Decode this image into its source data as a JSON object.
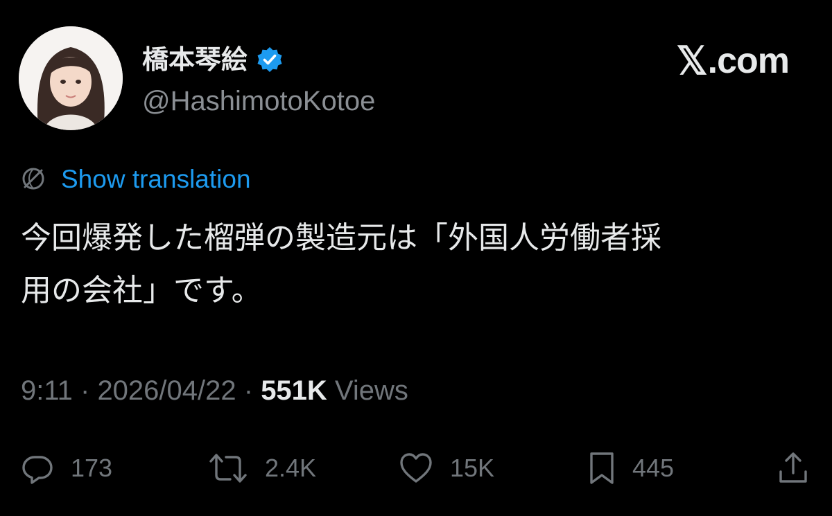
{
  "user": {
    "display_name": "橋本琴絵",
    "handle": "@HashimotoKotoe",
    "verified": true
  },
  "brand": {
    "x": "𝕏",
    "domain": ".com"
  },
  "translation": {
    "label": "Show translation"
  },
  "tweet": {
    "text": "今回爆発した榴弾の製造元は「外国人労働者採\n用の会社」です。"
  },
  "meta": {
    "time": "9:11",
    "separator": " · ",
    "date": "2026/04/22",
    "views_count": "551K",
    "views_label": " Views"
  },
  "actions": {
    "replies": "173",
    "reposts": "2.4K",
    "likes": "15K",
    "bookmarks": "445"
  },
  "colors": {
    "background": "#000000",
    "text": "#e7e9ea",
    "secondary": "#71767b",
    "accent": "#1d9bf0"
  },
  "icons": [
    "verified-badge-icon",
    "globe-icon",
    "reply-icon",
    "repost-icon",
    "like-icon",
    "bookmark-icon",
    "share-icon"
  ]
}
